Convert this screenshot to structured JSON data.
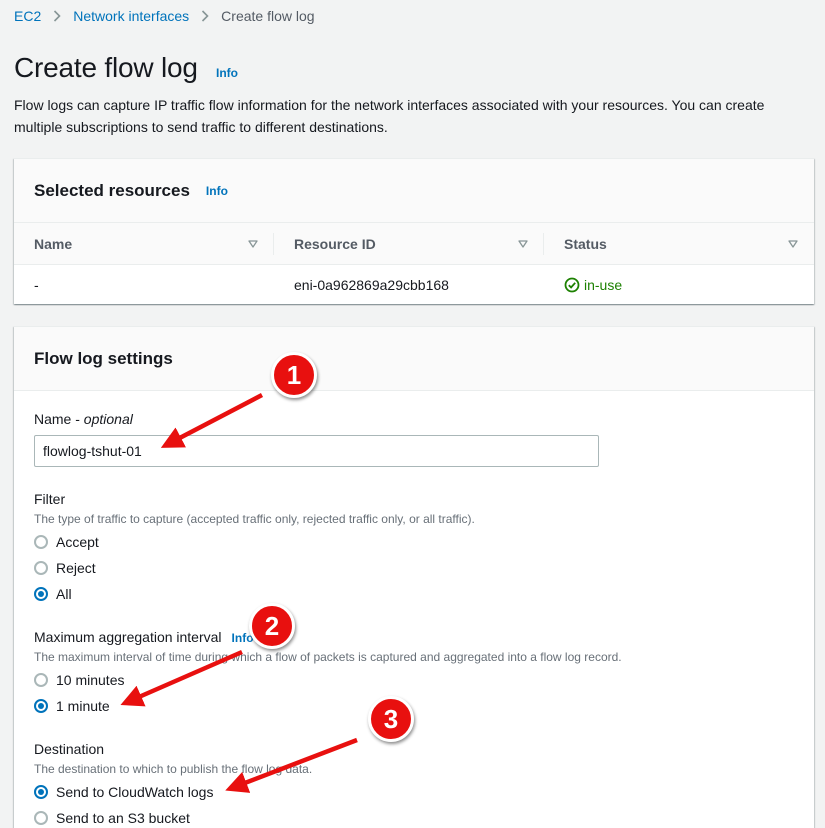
{
  "breadcrumb": {
    "items": [
      "EC2",
      "Network interfaces"
    ],
    "current": "Create flow log"
  },
  "page": {
    "title": "Create flow log",
    "info": "Info",
    "description": "Flow logs can capture IP traffic flow information for the network interfaces associated with your resources. You can create multiple subscriptions to send traffic to different destinations."
  },
  "resources": {
    "title": "Selected resources",
    "info": "Info",
    "columns": [
      "Name",
      "Resource ID",
      "Status"
    ],
    "rows": [
      {
        "name": "-",
        "resource_id": "eni-0a962869a29cbb168",
        "status": "in-use"
      }
    ]
  },
  "settings": {
    "title": "Flow log settings",
    "name_label": "Name - ",
    "name_optional": "optional",
    "name_value": "flowlog-tshut-01",
    "filter": {
      "label": "Filter",
      "description": "The type of traffic to capture (accepted traffic only, rejected traffic only, or all traffic).",
      "options": [
        "Accept",
        "Reject",
        "All"
      ],
      "selected": "All"
    },
    "aggregation": {
      "label": "Maximum aggregation interval",
      "info": "Info",
      "description": "The maximum interval of time during which a flow of packets is captured and aggregated into a flow log record.",
      "options": [
        "10 minutes",
        "1 minute"
      ],
      "selected": "1 minute"
    },
    "destination": {
      "label": "Destination",
      "description": "The destination to which to publish the flow log data.",
      "options": [
        "Send to CloudWatch logs",
        "Send to an S3 bucket"
      ],
      "selected": "Send to CloudWatch logs"
    }
  },
  "annotations": {
    "badges": [
      "1",
      "2",
      "3"
    ],
    "color": "#e8100f"
  },
  "colors": {
    "link": "#0073bb",
    "success": "#1d8102",
    "background": "#f2f3f3"
  }
}
